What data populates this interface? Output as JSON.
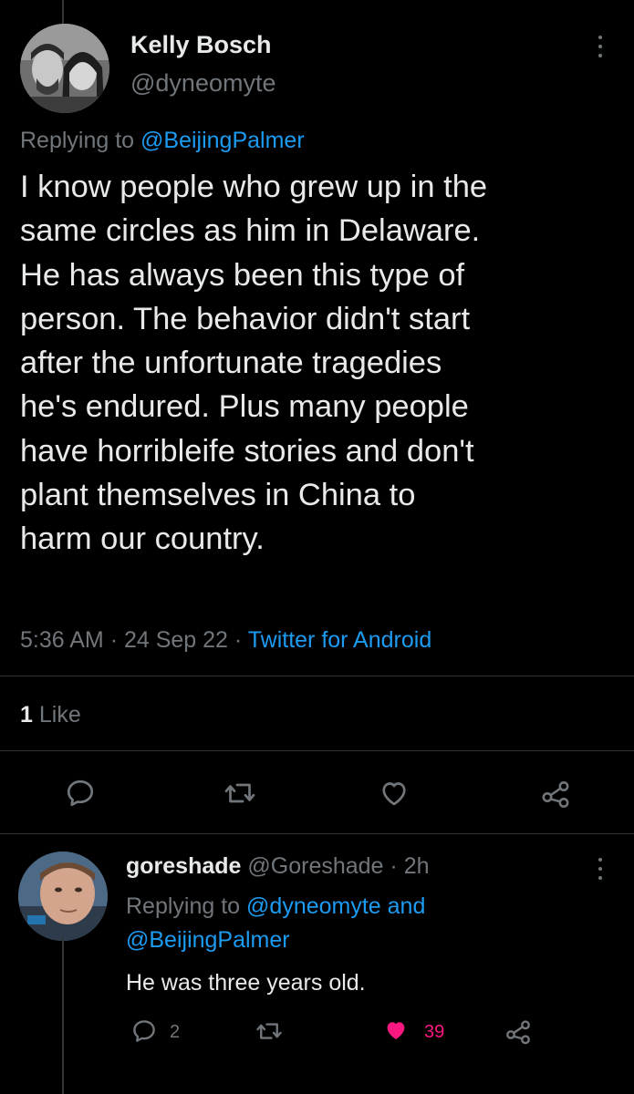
{
  "tweet": {
    "author_name": "Kelly Bosch",
    "author_handle": "@dyneomyte",
    "replying_prefix": "Replying to",
    "replying_to": "@BeijingPalmer",
    "body_lines": [
      "I know people who grew up in the",
      "same circles as him in Delaware.",
      "He has always been this type of",
      "person. The behavior didn't start",
      "after the unfortunate tragedies",
      "he's endured. Plus many people",
      "have horribleife stories and don't",
      "plant themselves in China to",
      "harm our country."
    ],
    "time": "5:36 AM",
    "separator": "·",
    "date": "24 Sep 22",
    "source": "Twitter for Android",
    "like_count": "1",
    "like_label": "Like"
  },
  "reply": {
    "author_name": "goreshade",
    "author_handle": "@Goreshade",
    "separator": "·",
    "time_ago": "2h",
    "replying_prefix": "Replying to",
    "replying_to_1": "@dyneomyte",
    "replying_and": "and",
    "replying_to_2": "@BeijingPalmer",
    "text": "He was three years old.",
    "reply_count": "2",
    "like_count": "39"
  },
  "icons": {
    "more": "more-vertical-icon",
    "reply": "reply-bubble-icon",
    "retweet": "retweet-icon",
    "like": "heart-icon",
    "share": "share-icon"
  },
  "colors": {
    "background": "#000000",
    "text": "#e7e9ea",
    "muted": "#71767b",
    "link": "#1d9bf0",
    "like_active": "#f91880",
    "divider": "#2f3336"
  }
}
